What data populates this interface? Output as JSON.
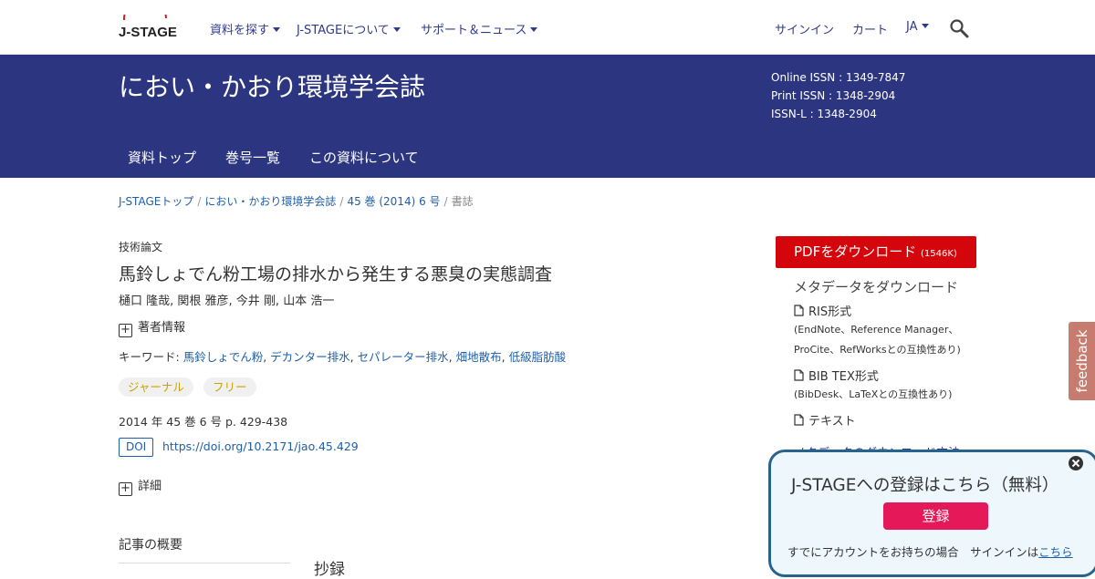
{
  "topnav": {
    "logo_text": "J-STAGE",
    "items": [
      "資料を探す",
      "J-STAGEについて",
      "サポート＆ニュース"
    ],
    "signin": "サインイン",
    "cart": "カート",
    "lang": "JA",
    "icons": {
      "search": "search-icon",
      "caret": "chevron-down-icon"
    }
  },
  "banner": {
    "title": "におい・かおり環境学会誌",
    "issn_online": "Online ISSN : 1349-7847",
    "issn_print": "Print ISSN : 1348-2904",
    "issn_l": "ISSN-L : 1348-2904",
    "subnav": [
      "資料トップ",
      "巻号一覧",
      "この資料について"
    ]
  },
  "breadcrumb": {
    "items": [
      "J-STAGEトップ",
      "におい・かおり環境学会誌",
      "45 巻 (2014) 6 号"
    ],
    "current": "書誌",
    "separator": "/"
  },
  "article": {
    "type": "技術論文",
    "title": "馬鈴しょでん粉工場の排水から発生する悪臭の実態調査",
    "authors": "樋口 隆哉, 関根 雅彦, 今井 剛, 山本 浩一",
    "author_info": "著者情報",
    "keywords_label": "キーワード: ",
    "keywords": [
      "馬鈴しょでん粉",
      "デカンター排水",
      "セパレーター排水",
      "畑地散布",
      "低級脂肪酸"
    ],
    "tags": [
      "ジャーナル",
      "フリー"
    ],
    "citation": "2014 年 45 巻 6 号 p. 429-438",
    "doi_label": "DOI",
    "doi_url": "https://doi.org/10.2171/jao.45.429",
    "details": "詳細",
    "summary_label": "記事の概要",
    "abstract_heading": "抄録"
  },
  "sidebar": {
    "pdf_label": "PDFをダウンロード",
    "pdf_size": "(1546K)",
    "meta_heading": "メタデータをダウンロード",
    "ris_label": "RIS形式",
    "ris_note1": "(EndNote、Reference Manager、",
    "ris_note2": "ProCite、RefWorksとの互換性あり)",
    "bibtex_label": "BIB TEX形式",
    "bibtex_note": "(BibDesk、LaTeXとの互換性あり)",
    "text_label": "テキスト",
    "cut_text": "メタデータのダウンロード方法"
  },
  "feedback": {
    "label": "feedback"
  },
  "popup": {
    "title": "J-STAGEへの登録はこちら（無料）",
    "button": "登録",
    "foot_text": "すでにアカウントをお持ちの場合　サインインは",
    "foot_link": "こちら"
  },
  "colors": {
    "banner": "#2c3580",
    "pdf_button": "#d4050b",
    "link": "#1f5fa8",
    "popup_button": "#e5195a",
    "popup_border": "#27638c",
    "feedback": "#c87c70"
  }
}
